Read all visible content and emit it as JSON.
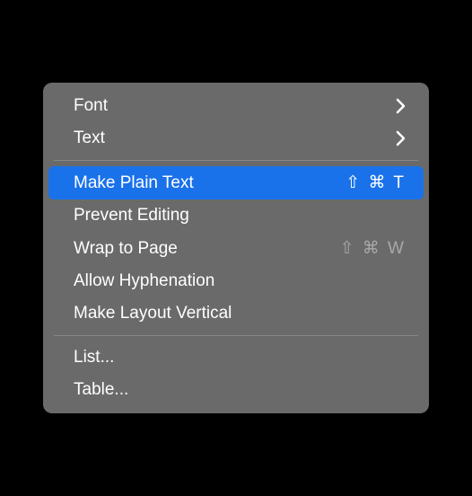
{
  "menu": {
    "sections": [
      {
        "items": [
          {
            "id": "font",
            "label": "Font",
            "has_submenu": true,
            "shortcut": ""
          },
          {
            "id": "text",
            "label": "Text",
            "has_submenu": true,
            "shortcut": ""
          }
        ]
      },
      {
        "items": [
          {
            "id": "make-plain-text",
            "label": "Make Plain Text",
            "has_submenu": false,
            "shortcut": "⇧ ⌘ T",
            "highlighted": true
          },
          {
            "id": "prevent-editing",
            "label": "Prevent Editing",
            "has_submenu": false,
            "shortcut": ""
          },
          {
            "id": "wrap-to-page",
            "label": "Wrap to Page",
            "has_submenu": false,
            "shortcut": "⇧ ⌘ W",
            "shortcut_dimmed": true
          },
          {
            "id": "allow-hyphenation",
            "label": "Allow Hyphenation",
            "has_submenu": false,
            "shortcut": ""
          },
          {
            "id": "make-layout-vertical",
            "label": "Make Layout Vertical",
            "has_submenu": false,
            "shortcut": ""
          }
        ]
      },
      {
        "items": [
          {
            "id": "list",
            "label": "List...",
            "has_submenu": false,
            "shortcut": ""
          },
          {
            "id": "table",
            "label": "Table...",
            "has_submenu": false,
            "shortcut": ""
          }
        ]
      }
    ]
  }
}
